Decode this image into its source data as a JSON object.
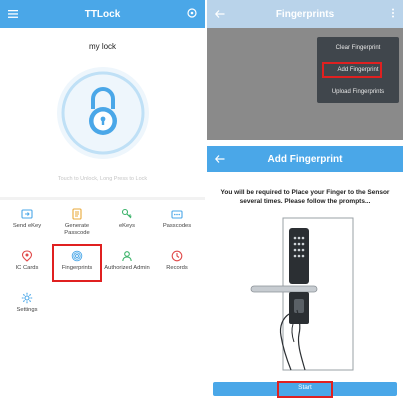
{
  "colors": {
    "primary": "#4aa7e8",
    "highlight": "#e02020",
    "menu_bg": "#40464c"
  },
  "home": {
    "title": "TTLock",
    "menu_icon": "hamburger-icon",
    "settings_icon": "target-icon",
    "lock_name": "my lock",
    "unlock_hint": "Touch to Unlock, Long Press to Lock",
    "items": [
      {
        "label": "Send eKey",
        "icon": "send-key-icon"
      },
      {
        "label": "Generate Passcode",
        "icon": "generate-passcode-icon"
      },
      {
        "label": "eKeys",
        "icon": "ekeys-icon"
      },
      {
        "label": "Passcodes",
        "icon": "passcodes-icon"
      },
      {
        "label": "IC Cards",
        "icon": "ic-card-icon"
      },
      {
        "label": "Fingerprints",
        "icon": "fingerprint-icon"
      },
      {
        "label": "Authorized Admin",
        "icon": "admin-icon"
      },
      {
        "label": "Records",
        "icon": "records-icon"
      },
      {
        "label": "Settings",
        "icon": "settings-icon"
      }
    ]
  },
  "fingerprints_screen": {
    "title": "Fingerprints",
    "back_icon": "back-arrow-icon",
    "more_icon": "more-vertical-icon",
    "menu": [
      "Clear Fingerprint",
      "Add Fingerprint",
      "Upload Fingerprints"
    ]
  },
  "add_fingerprint_screen": {
    "title": "Add Fingerprint",
    "back_icon": "back-arrow-icon",
    "instructions": "You will be required to Place your Finger to the Sensor several times. Please follow the prompts...",
    "start_label": "Start"
  }
}
